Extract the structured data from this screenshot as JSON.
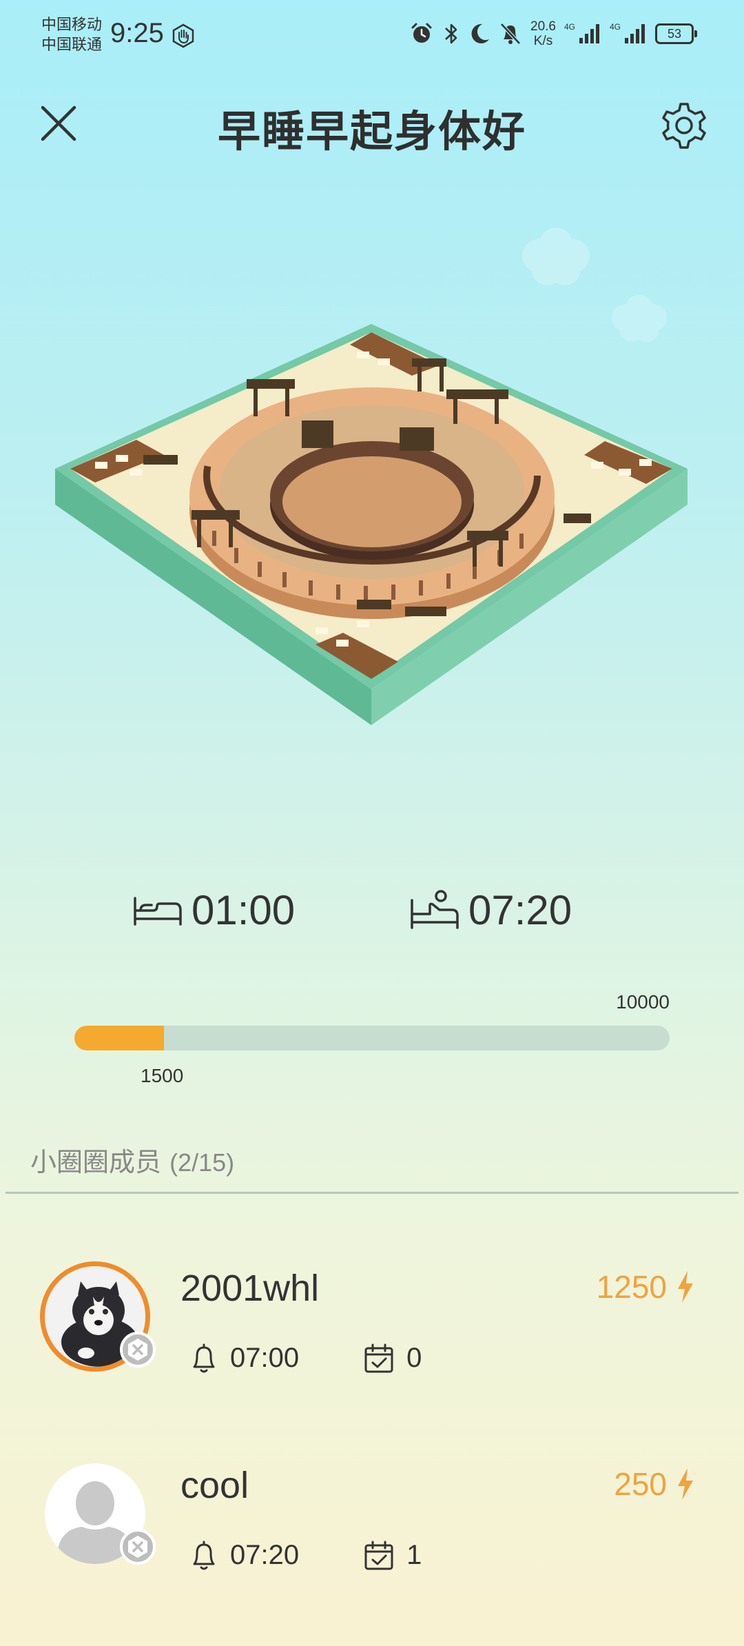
{
  "status_bar": {
    "carrier_1": "中国移动",
    "carrier_2": "中国联通",
    "time": "9:25",
    "net_speed_value": "20.6",
    "net_speed_unit": "K/s",
    "net_tag_1": "4G",
    "net_tag_2": "4G",
    "battery": "53"
  },
  "header": {
    "title": "早睡早起身体好"
  },
  "schedule": {
    "sleep_time": "01:00",
    "wake_time": "07:20"
  },
  "progress": {
    "goal": "10000",
    "current": "1500",
    "fill_fraction": 0.15,
    "fill_color": "#f4aa2e"
  },
  "members_section": {
    "title": "小圈圈成员",
    "count": "(2/15)"
  },
  "members": [
    {
      "name": "2001whl",
      "energy": "1250",
      "alarm": "07:00",
      "checkins": "0",
      "avatar": "husky-puppy-photo"
    },
    {
      "name": "cool",
      "energy": "250",
      "alarm": "07:20",
      "checkins": "1",
      "avatar": "default-person-avatar"
    }
  ],
  "colors": {
    "accent_orange": "#f0a33e",
    "ring_orange": "#f08c2c"
  }
}
